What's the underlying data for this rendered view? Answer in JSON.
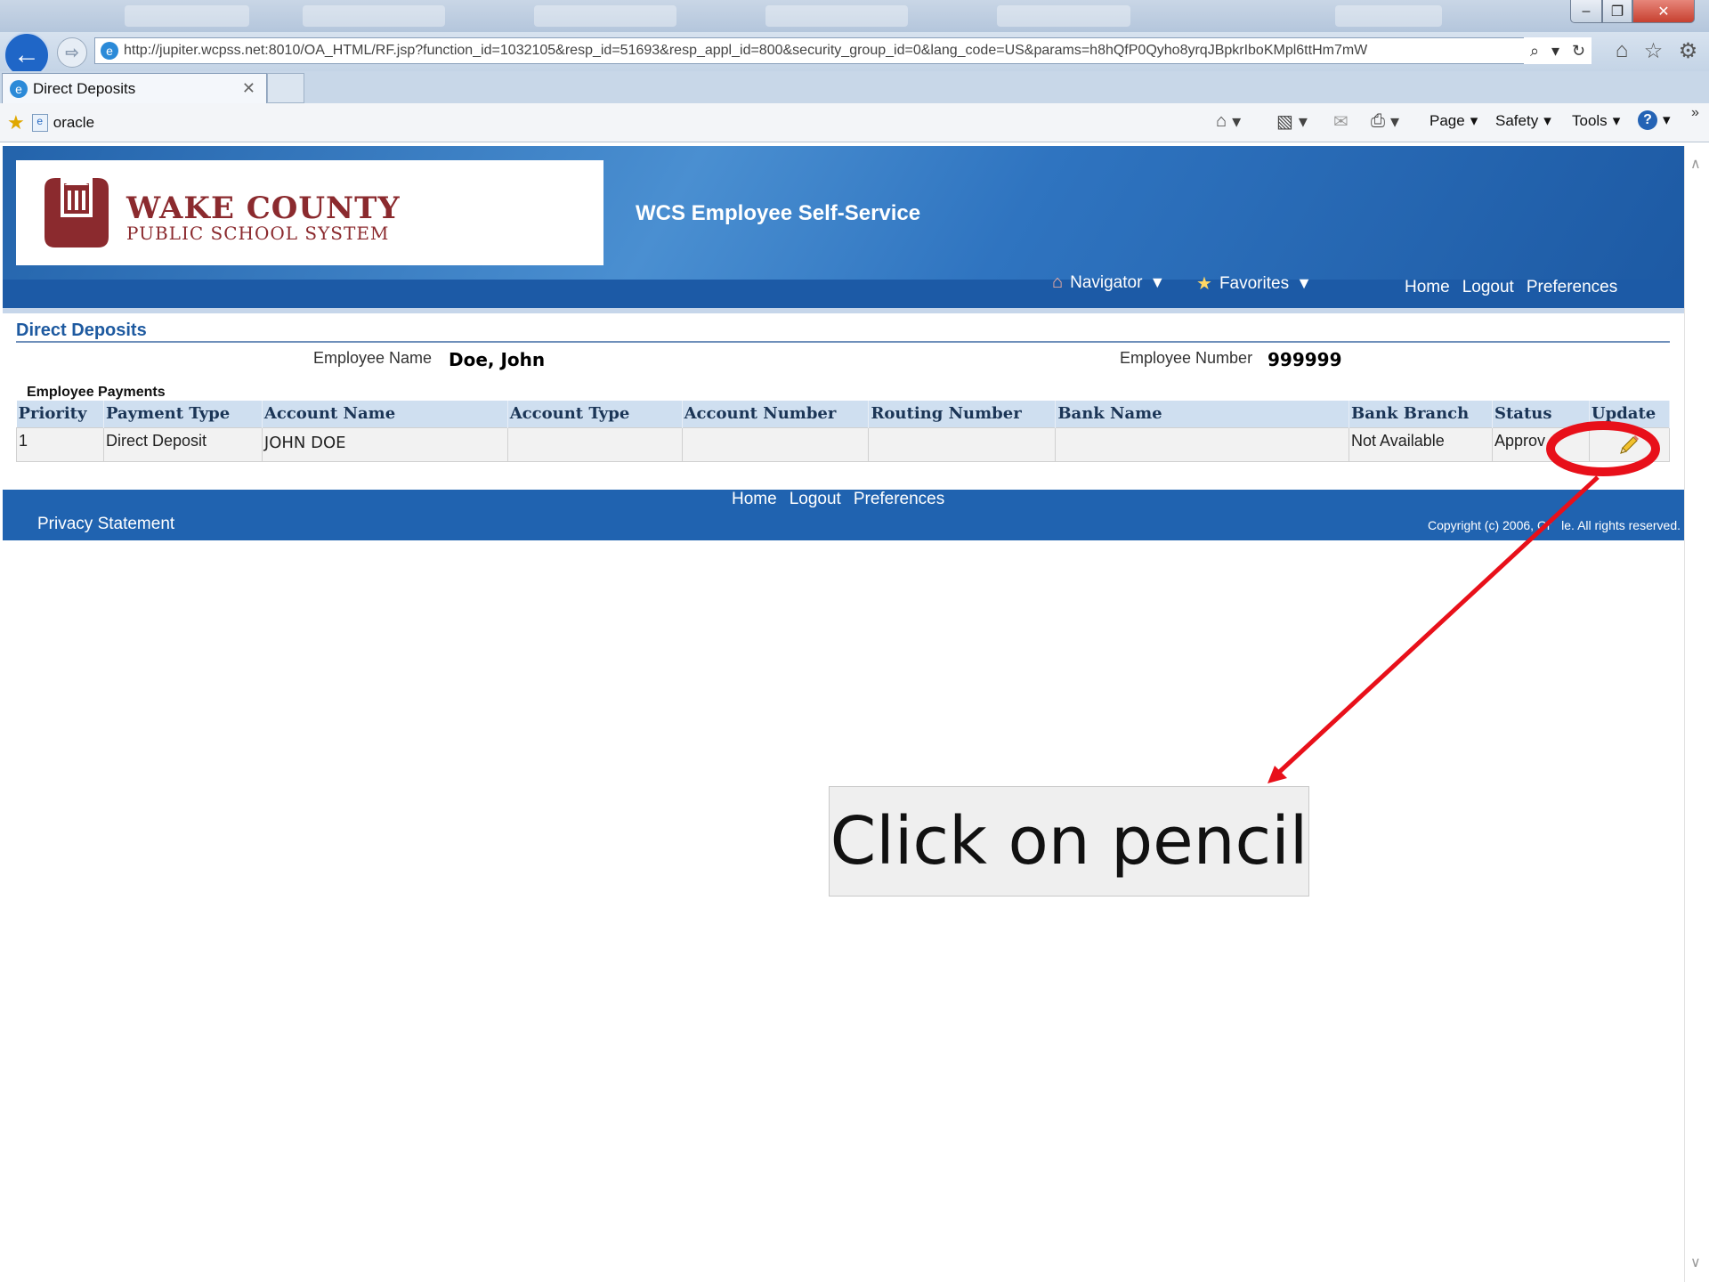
{
  "browser": {
    "address_url": "http://jupiter.wcpss.net:8010/OA_HTML/RF.jsp?function_id=1032105&resp_id=51693&resp_appl_id=800&security_group_id=0&lang_code=US&params=h8hQfP0Qyho8yrqJBpkrIboKMpl6ttHm7mW",
    "tab_title": "Direct Deposits",
    "favorites_item": "oracle",
    "commands": {
      "page": "Page",
      "safety": "Safety",
      "tools": "Tools"
    }
  },
  "header": {
    "logo_line1": "WAKE COUNTY",
    "logo_line2": "PUBLIC SCHOOL SYSTEM",
    "app_title": "WCS Employee Self-Service",
    "navigator": "Navigator",
    "favorites": "Favorites",
    "links": {
      "home": "Home",
      "logout": "Logout",
      "preferences": "Preferences"
    }
  },
  "page": {
    "heading": "Direct Deposits",
    "employee_name_label": "Employee Name",
    "employee_name": "Doe, John",
    "employee_number_label": "Employee Number",
    "employee_number": "999999",
    "section_title": "Employee Payments"
  },
  "table": {
    "headers": [
      "Priority",
      "Payment Type",
      "Account Name",
      "Account Type",
      "Account Number",
      "Routing Number",
      "Bank Name",
      "Bank Branch",
      "Status",
      "Update"
    ],
    "row": {
      "priority": "1",
      "payment_type": "Direct Deposit",
      "account_name": "JOHN DOE",
      "account_type": "",
      "account_number": "",
      "routing_number": "",
      "bank_name": "",
      "bank_branch": "Not Available",
      "status": "Approv"
    }
  },
  "footer": {
    "links": {
      "home": "Home",
      "logout": "Logout",
      "preferences": "Preferences"
    },
    "privacy": "Privacy Statement",
    "copyright": "Copyright (c) 2006, Or   le. All rights reserved."
  },
  "annotation": {
    "callout": "Click on pencil"
  },
  "colors": {
    "brand_maroon": "#8b2a2e",
    "header_blue": "#1c5aa6",
    "annotation_red": "#e8101a"
  }
}
